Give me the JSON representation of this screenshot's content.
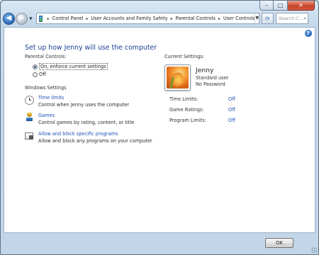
{
  "window": {
    "caption": {
      "minimize": "–",
      "maximize": "□",
      "close": "✕"
    }
  },
  "nav": {
    "back_glyph": "◀",
    "forward_glyph": "▶",
    "breadcrumbs": [
      "Control Panel",
      "User Accounts and Family Safety",
      "Parental Controls",
      "User Controls"
    ],
    "breadcrumb_separator": "▸",
    "search_placeholder": "Search C..."
  },
  "page": {
    "title": "Set up how Jenny will use the computer",
    "parental_controls_label": "Parental Controls:",
    "options": [
      {
        "label": "On, enforce current settings",
        "selected": true
      },
      {
        "label": "Off",
        "selected": false
      }
    ],
    "windows_settings_label": "Windows Settings",
    "tasks": [
      {
        "icon": "clock-icon",
        "link": "Time limits",
        "desc": "Control when Jenny uses the computer"
      },
      {
        "icon": "games-icon",
        "link": "Games",
        "desc": "Control games by rating, content, or title"
      },
      {
        "icon": "program-block-icon",
        "link": "Allow and block specific programs",
        "desc": "Allow and block any programs on your computer"
      }
    ]
  },
  "current": {
    "label": "Current Settings:",
    "user_name": "Jenny",
    "account_type": "Standard user",
    "password_status": "No Password",
    "settings": [
      {
        "label": "Time Limits:",
        "value": "Off"
      },
      {
        "label": "Game Ratings:",
        "value": "Off"
      },
      {
        "label": "Program Limits:",
        "value": "Off"
      }
    ]
  },
  "footer": {
    "ok_label": "OK"
  },
  "help": "?"
}
